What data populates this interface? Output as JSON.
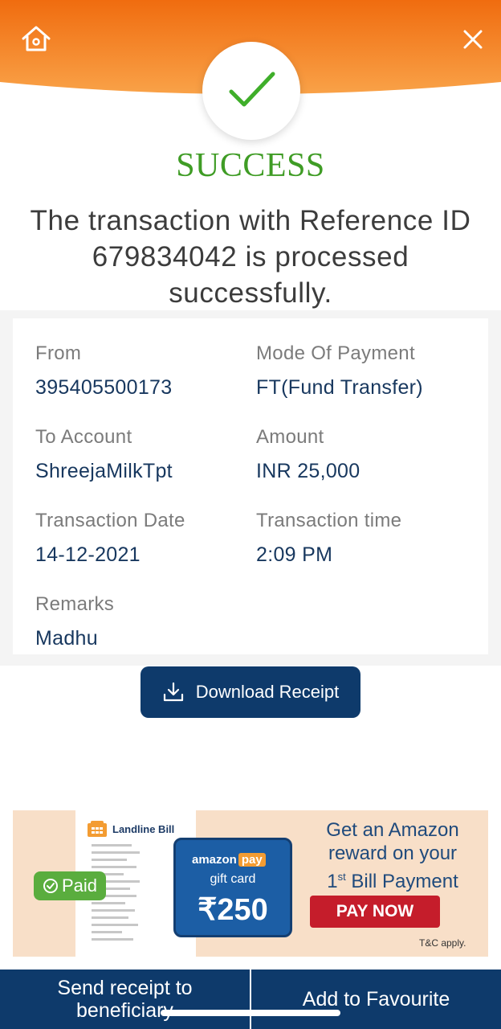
{
  "header": {
    "home_icon": "home-icon",
    "close_icon": "close-icon",
    "status_icon": "checkmark-icon",
    "gradient": [
      "#f06c0f",
      "#f9a248"
    ]
  },
  "status": {
    "title": "SUCCESS",
    "message": "The transaction with Reference ID 679834042 is processed successfully.",
    "color": "#3f9c25"
  },
  "details": {
    "from": {
      "label": "From",
      "value": "395405500173"
    },
    "mode_of_payment": {
      "label": "Mode Of Payment",
      "value": "FT(Fund Transfer)"
    },
    "to_account": {
      "label": "To Account",
      "value": "ShreejaMilkTpt"
    },
    "amount": {
      "label": "Amount",
      "value": "INR 25,000"
    },
    "transaction_date": {
      "label": "Transaction Date",
      "value": "14-12-2021"
    },
    "transaction_time": {
      "label": "Transaction time",
      "value": "2:09 PM"
    },
    "remarks": {
      "label": "Remarks",
      "value": "Madhu"
    }
  },
  "download_button": {
    "label": "Download Receipt",
    "icon": "download-icon"
  },
  "banner": {
    "bill_title": "Landline Bill",
    "paid_label": "Paid",
    "card_brand": "amazon",
    "card_brand_pay": "pay",
    "card_subtitle": "gift card",
    "card_amount": "₹250",
    "promo_line1": "Get an Amazon",
    "promo_line2": "reward on your",
    "promo_line3_num": "1",
    "promo_line3_sup": "st",
    "promo_line3_rest": " Bill Payment",
    "cta": "PAY NOW",
    "terms": "T&C apply."
  },
  "bottom_bar": {
    "send_receipt_line1": "Send receipt to",
    "send_receipt_line2": "beneficiary",
    "add_favourite": "Add to Favourite"
  },
  "colors": {
    "primary_navy": "#0e3a6b",
    "value_text": "#17375e",
    "label_text": "#7b7b7b"
  }
}
